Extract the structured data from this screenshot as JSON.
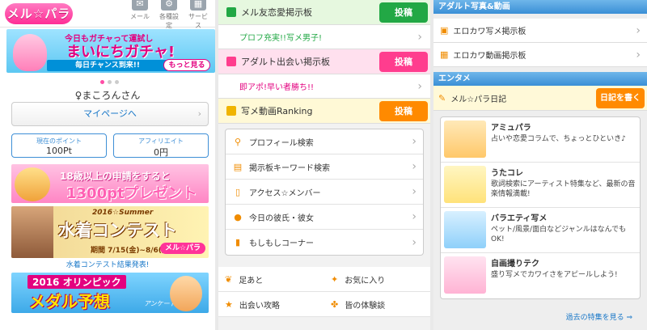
{
  "header": {
    "logo": "メル☆パラ",
    "icons": [
      {
        "label": "メール",
        "icon": "mail-icon"
      },
      {
        "label": "各種設定",
        "icon": "gear-icon"
      },
      {
        "label": "サービス",
        "icon": "grid-icon"
      }
    ]
  },
  "gacha_banner": {
    "line1": "今日もガチャって運試し",
    "title": "まいにちガチャ!",
    "tagline": "毎日チャンス到来!!",
    "more": "もっと見る"
  },
  "profile": {
    "name": "♀まころんさん",
    "mypage_label": "マイページへ",
    "points_label": "現在のポイント",
    "points_value": "100Pt",
    "affiliate_label": "アフィリエイト",
    "affiliate_value": "0円"
  },
  "banners": {
    "present_line1": "18歳以上の申請をすると",
    "present_line2": "1300ptプレゼント",
    "contest_small": "2016☆Summer",
    "contest_title": "水着コンテスト",
    "contest_period": "期間 7/15(金)~8/6(土)",
    "contest_logo": "メル☆パラ",
    "contest_result": "水着コンテスト結果発表!",
    "olympic_line1": "2016 オリンピック",
    "olympic_line2": "メダル予想",
    "olympic_sub": "アンケート"
  },
  "boards": [
    {
      "title": "メル友恋愛掲示板",
      "post": "投稿",
      "sub": "プロフ充実!!写メ男子!",
      "color": "#e6f8df",
      "btn": "#22a845",
      "subcolor": "#22a845"
    },
    {
      "title": "アダルト出会い掲示板",
      "post": "投稿",
      "sub": "即アポ!早い者勝ち!!",
      "color": "#ffe0ee",
      "btn": "#ff3d8e",
      "subcolor": "#e3007f"
    },
    {
      "title": "写メ動画Ranking",
      "post": "投稿",
      "color": "#fff9d6",
      "btn": "#ff8a00"
    }
  ],
  "search_menu": [
    {
      "label": "プロフィール検索",
      "icon": "magnifier-icon"
    },
    {
      "label": "掲示板キーワード検索",
      "icon": "board-icon"
    },
    {
      "label": "アクセス☆メンバー",
      "icon": "document-icon"
    },
    {
      "label": "今日の彼氏・彼女",
      "icon": "chat-icon"
    },
    {
      "label": "もしもしコーナー",
      "icon": "phone-icon"
    }
  ],
  "quick_links": [
    {
      "label": "足あと",
      "icon": "footprint-icon"
    },
    {
      "label": "お気に入り",
      "icon": "sparkle-icon"
    },
    {
      "label": "出会い攻略",
      "icon": "star-icon"
    },
    {
      "label": "皆の体験談",
      "icon": "clover-icon"
    }
  ],
  "adult_section": {
    "heading": "アダルト写真&動画",
    "items": [
      {
        "label": "エロカワ写メ掲示板",
        "icon": "photo-board-icon"
      },
      {
        "label": "エロカワ動画掲示板",
        "icon": "film-icon"
      }
    ]
  },
  "entame_section": {
    "heading": "エンタメ",
    "diary": "メル☆パラ日記",
    "diary_button": "日記を書く",
    "features": [
      {
        "title": "アミュパラ",
        "desc": "占いや恋愛コラムで、ちょっとひといき♪",
        "thumb": "#ffe3a0"
      },
      {
        "title": "うたコレ",
        "desc": "歌詞検索にアーティスト特集など、最新の音楽情報満載!",
        "thumb": "#fff1a8"
      },
      {
        "title": "バラエティ写メ",
        "desc": "ペット/風景/面白などジャンルはなんでもOK!",
        "thumb": "#bfe6ff"
      },
      {
        "title": "自画撮りテク",
        "desc": "盛り写メでカワイさをアピールしよう!",
        "thumb": "#ffd7ea"
      }
    ],
    "past_link": "過去の特集を見る ⇒"
  }
}
